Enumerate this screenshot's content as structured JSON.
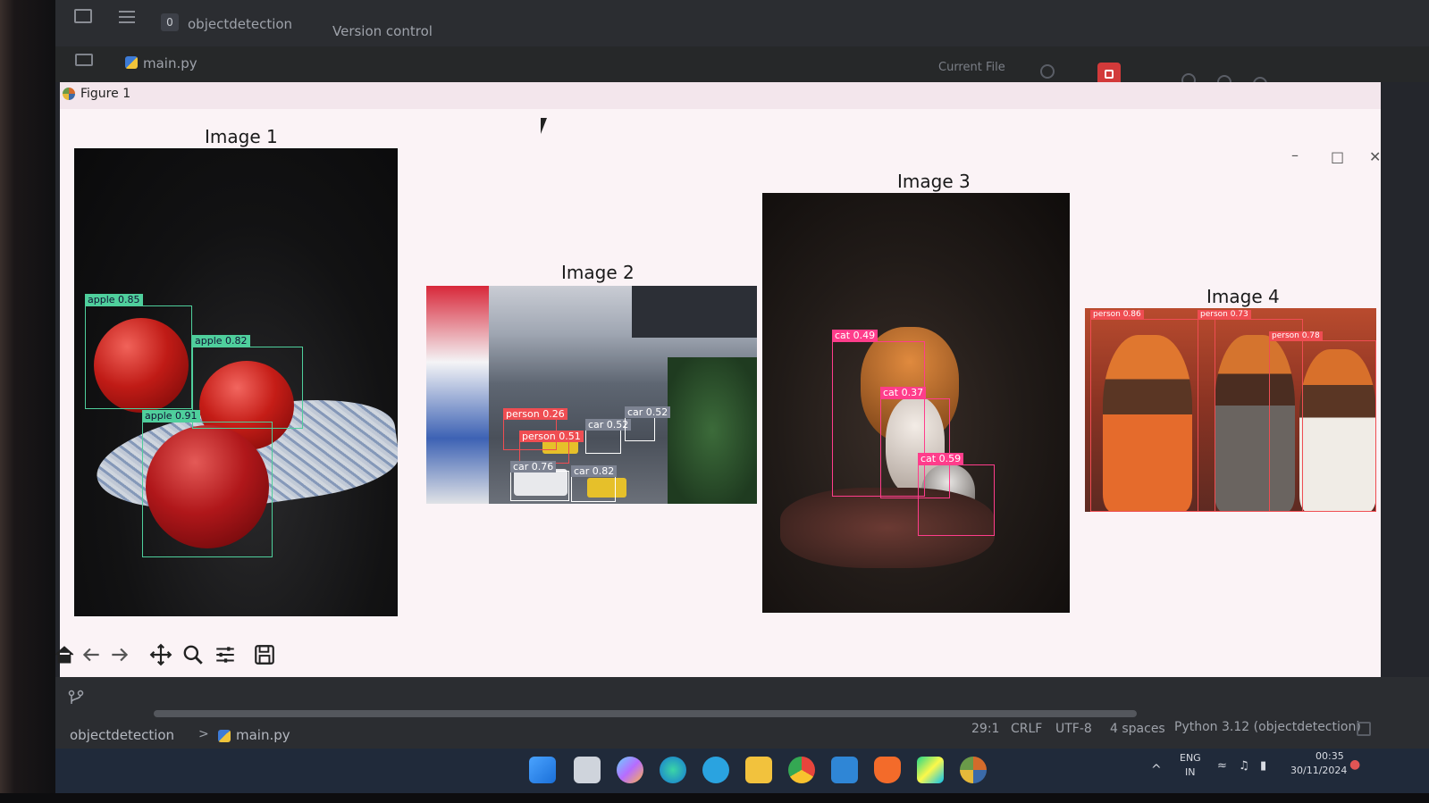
{
  "ide": {
    "project_badge": "0",
    "project_name": "objectdetection",
    "menu_version_control": "Version control",
    "open_file_tab": "main.py",
    "run_config": "Current File"
  },
  "figure": {
    "window_title": "Figure 1",
    "panels": [
      {
        "title": "Image 1",
        "detections": [
          {
            "label": "apple 0.85"
          },
          {
            "label": "apple 0.82"
          },
          {
            "label": "apple 0.91"
          }
        ]
      },
      {
        "title": "Image 2",
        "detections": [
          {
            "label": "person 0.26"
          },
          {
            "label": "person 0.51"
          },
          {
            "label": "car 0.76"
          },
          {
            "label": "car 0.82"
          },
          {
            "label": "car 0.52"
          },
          {
            "label": "car 0.52"
          }
        ]
      },
      {
        "title": "Image 3",
        "detections": [
          {
            "label": "cat 0.49"
          },
          {
            "label": "cat 0.37"
          },
          {
            "label": "cat 0.59"
          }
        ]
      },
      {
        "title": "Image 4",
        "detections": [
          {
            "label": "person 0.86"
          },
          {
            "label": "person 0.73"
          },
          {
            "label": "person 0.78"
          }
        ]
      }
    ],
    "toolbar_icons": [
      "home-icon",
      "back-arrow-icon",
      "forward-arrow-icon",
      "pan-icon",
      "zoom-icon",
      "configure-subplots-icon",
      "save-icon"
    ]
  },
  "statusbar": {
    "breadcrumb_project": "objectdetection",
    "breadcrumb_sep": ">",
    "breadcrumb_file": "main.py",
    "cursor_pos": "29:1",
    "line_sep": "CRLF",
    "encoding": "UTF-8",
    "indent": "4 spaces",
    "interpreter": "Python 3.12 (objectdetection)"
  },
  "taskbar": {
    "lang_top": "ENG",
    "lang_bottom": "IN",
    "time": "00:35",
    "date": "30/11/2024"
  },
  "colors": {
    "box_green": "#4fcf9c",
    "box_pink": "#ff3d8b",
    "box_red": "#ef4d52",
    "figure_bg": "#fbf3f6"
  }
}
